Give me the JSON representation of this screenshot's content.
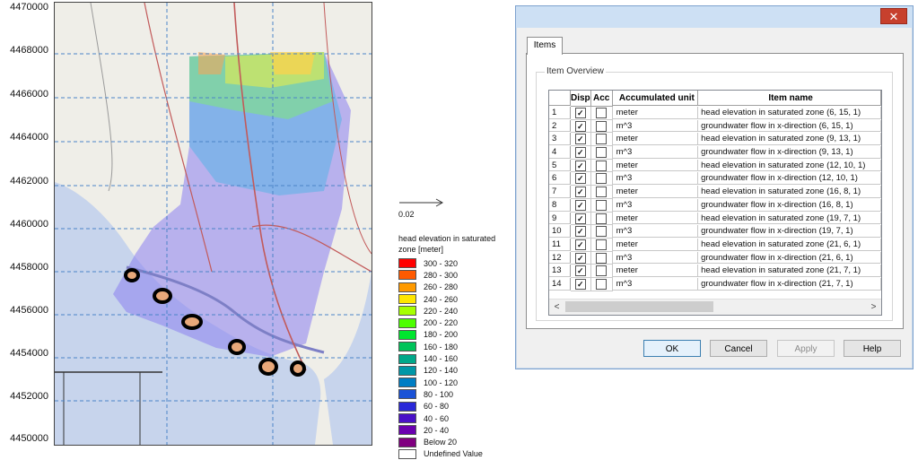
{
  "map": {
    "y_ticks": [
      "4470000",
      "4468000",
      "4466000",
      "4464000",
      "4462000",
      "4460000",
      "4458000",
      "4456000",
      "4454000",
      "4452000",
      "4450000"
    ]
  },
  "legend": {
    "arrow_label": "0.02",
    "title": "head elevation in saturated zone [meter]",
    "items": [
      {
        "label": "300 - 320",
        "color": "#ff0000"
      },
      {
        "label": "280 - 300",
        "color": "#ff5a00"
      },
      {
        "label": "260 - 280",
        "color": "#ff9a00"
      },
      {
        "label": "240 - 260",
        "color": "#ffe600"
      },
      {
        "label": "220 - 240",
        "color": "#a6ff00"
      },
      {
        "label": "200 - 220",
        "color": "#4dff00"
      },
      {
        "label": "180 - 200",
        "color": "#00e62e"
      },
      {
        "label": "160 - 180",
        "color": "#00c45a"
      },
      {
        "label": "140 - 160",
        "color": "#00a88a"
      },
      {
        "label": "120 - 140",
        "color": "#0097a7"
      },
      {
        "label": "100 - 120",
        "color": "#007ec4"
      },
      {
        "label": "80 - 100",
        "color": "#1a52d6"
      },
      {
        "label": "60 - 80",
        "color": "#2a28d8"
      },
      {
        "label": "40 - 60",
        "color": "#4a10c8"
      },
      {
        "label": "20 - 40",
        "color": "#6a00b0"
      },
      {
        "label": "Below 20",
        "color": "#800080"
      },
      {
        "label": "Undefined Value",
        "color": "#ffffff"
      }
    ]
  },
  "dialog": {
    "close_label": "✕",
    "tab_label": "Items",
    "group_title": "Item Overview",
    "columns": [
      "",
      "Disp",
      "Acc",
      "Accumulated unit",
      "Item name"
    ],
    "rows": [
      {
        "idx": "1",
        "disp": true,
        "acc": false,
        "unit": "meter",
        "name": "head elevation in saturated zone (6, 15, 1)"
      },
      {
        "idx": "2",
        "disp": true,
        "acc": false,
        "unit": "m^3",
        "name": "groundwater flow in x-direction (6, 15, 1)"
      },
      {
        "idx": "3",
        "disp": true,
        "acc": false,
        "unit": "meter",
        "name": "head elevation in saturated zone (9, 13, 1)"
      },
      {
        "idx": "4",
        "disp": true,
        "acc": false,
        "unit": "m^3",
        "name": "groundwater flow in x-direction (9, 13, 1)"
      },
      {
        "idx": "5",
        "disp": true,
        "acc": false,
        "unit": "meter",
        "name": "head elevation in saturated zone (12, 10, 1)"
      },
      {
        "idx": "6",
        "disp": true,
        "acc": false,
        "unit": "m^3",
        "name": "groundwater flow in x-direction (12, 10, 1)"
      },
      {
        "idx": "7",
        "disp": true,
        "acc": false,
        "unit": "meter",
        "name": "head elevation in saturated zone (16, 8, 1)"
      },
      {
        "idx": "8",
        "disp": true,
        "acc": false,
        "unit": "m^3",
        "name": "groundwater flow in x-direction (16, 8, 1)"
      },
      {
        "idx": "9",
        "disp": true,
        "acc": false,
        "unit": "meter",
        "name": "head elevation in saturated zone (19, 7, 1)"
      },
      {
        "idx": "10",
        "disp": true,
        "acc": false,
        "unit": "m^3",
        "name": "groundwater flow in x-direction (19, 7, 1)"
      },
      {
        "idx": "11",
        "disp": true,
        "acc": false,
        "unit": "meter",
        "name": "head elevation in saturated zone (21, 6, 1)"
      },
      {
        "idx": "12",
        "disp": true,
        "acc": false,
        "unit": "m^3",
        "name": "groundwater flow in x-direction (21, 6, 1)"
      },
      {
        "idx": "13",
        "disp": true,
        "acc": false,
        "unit": "meter",
        "name": "head elevation in saturated zone (21, 7, 1)"
      },
      {
        "idx": "14",
        "disp": true,
        "acc": false,
        "unit": "m^3",
        "name": "groundwater flow in x-direction (21, 7, 1)"
      }
    ],
    "buttons": {
      "ok": "OK",
      "cancel": "Cancel",
      "apply": "Apply",
      "help": "Help"
    },
    "scroll_left": "<",
    "scroll_right": ">"
  }
}
